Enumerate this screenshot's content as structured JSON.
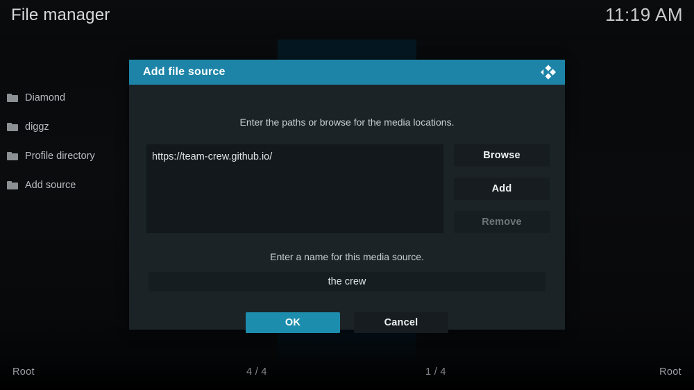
{
  "window": {
    "title": "File manager",
    "clock": "11:19 AM"
  },
  "file_list": {
    "items": [
      {
        "icon": "folder-icon",
        "label": "Diamond"
      },
      {
        "icon": "folder-icon",
        "label": "diggz"
      },
      {
        "icon": "folder-icon",
        "label": "Profile directory"
      },
      {
        "icon": "folder-icon",
        "label": "Add source"
      }
    ]
  },
  "dialog": {
    "title": "Add file source",
    "logo_icon": "kodi-logo-icon",
    "paths_hint": "Enter the paths or browse for the media locations.",
    "paths": [
      "https://team-crew.github.io/"
    ],
    "side_buttons": [
      {
        "label": "Browse",
        "enabled": true
      },
      {
        "label": "Add",
        "enabled": true
      },
      {
        "label": "Remove",
        "enabled": false
      }
    ],
    "name_hint": "Enter a name for this media source.",
    "name_value": "the crew",
    "name_placeholder": "Enter a name",
    "ok_label": "OK",
    "cancel_label": "Cancel"
  },
  "statusbar": {
    "left_label": "Root",
    "left_count": "4 / 4",
    "right_count": "1 / 4",
    "right_label": "Root"
  },
  "colors": {
    "accent": "#1d84a8",
    "accent_button": "#1d8dae",
    "dialog_bg": "#1b2327",
    "field_bg": "#12181b",
    "text_primary": "#dfe3e5",
    "text_muted": "#9aa0a4",
    "text_disabled": "#6e7478"
  }
}
